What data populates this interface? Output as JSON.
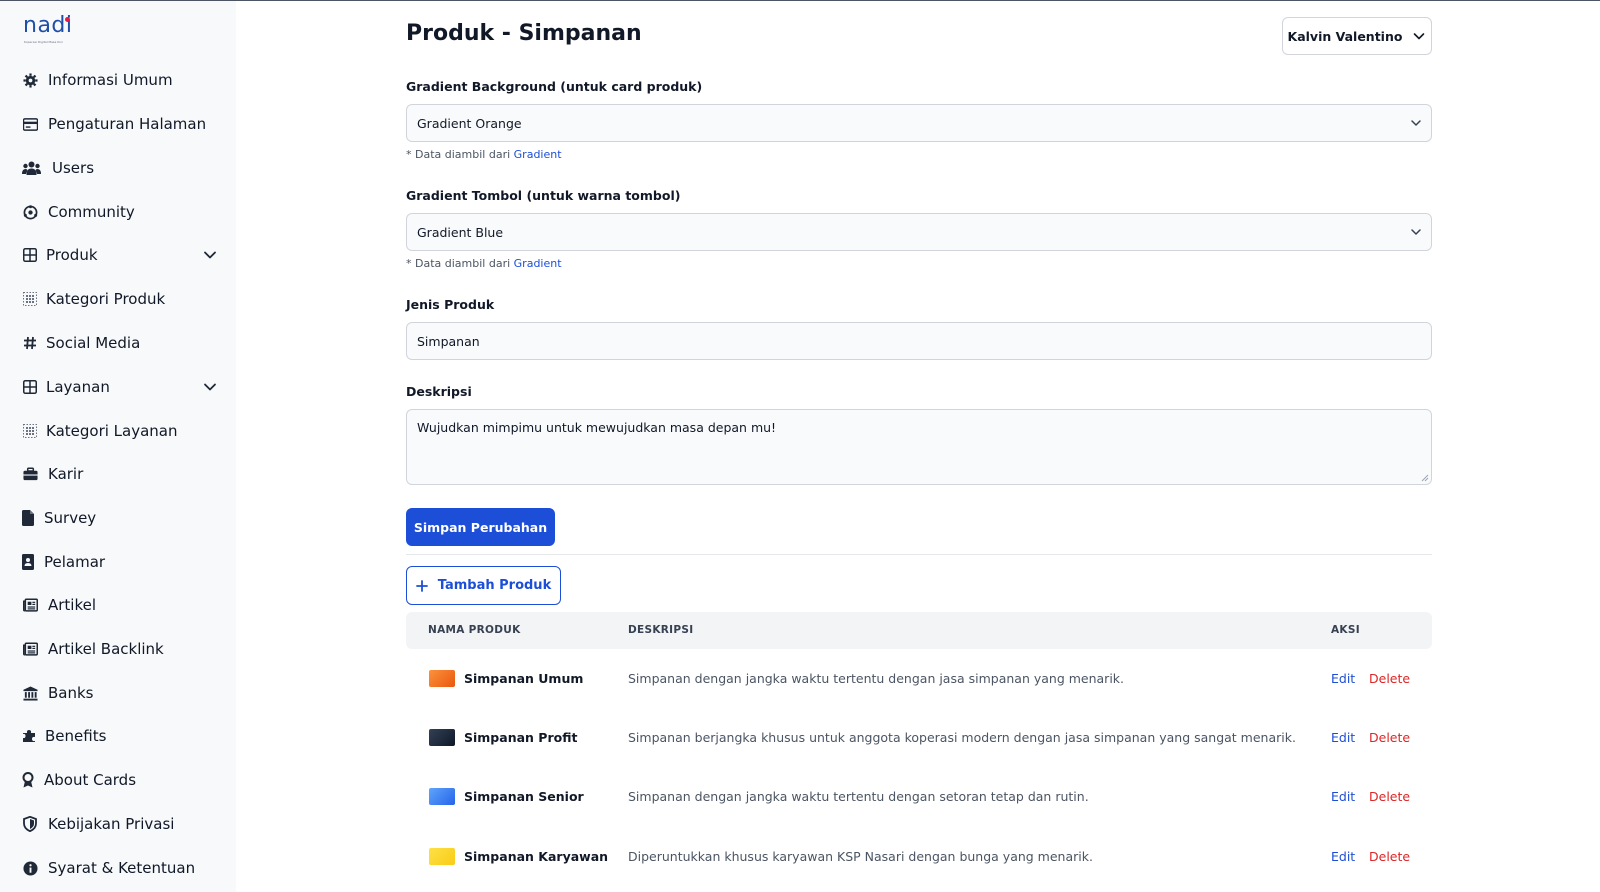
{
  "logo": {
    "text": "nadi",
    "subtitle": "Koperasi Digital Masa Kini"
  },
  "sidebar": {
    "items": [
      {
        "label": "Informasi Umum",
        "icon": "gear-icon"
      },
      {
        "label": "Pengaturan Halaman",
        "icon": "card-icon"
      },
      {
        "label": "Users",
        "icon": "users-icon"
      },
      {
        "label": "Community",
        "icon": "community-icon"
      },
      {
        "label": "Produk",
        "icon": "grid-icon",
        "expandable": true
      },
      {
        "label": "Kategori Produk",
        "icon": "dots-grid-icon"
      },
      {
        "label": "Social Media",
        "icon": "hash-icon"
      },
      {
        "label": "Layanan",
        "icon": "grid-icon",
        "expandable": true
      },
      {
        "label": "Kategori Layanan",
        "icon": "dots-grid-icon"
      },
      {
        "label": "Karir",
        "icon": "briefcase-icon"
      },
      {
        "label": "Survey",
        "icon": "document-icon"
      },
      {
        "label": "Pelamar",
        "icon": "id-card-icon"
      },
      {
        "label": "Artikel",
        "icon": "newspaper-icon"
      },
      {
        "label": "Artikel Backlink",
        "icon": "newspaper-icon"
      },
      {
        "label": "Banks",
        "icon": "bank-icon"
      },
      {
        "label": "Benefits",
        "icon": "puzzle-icon"
      },
      {
        "label": "About Cards",
        "icon": "award-icon"
      },
      {
        "label": "Kebijakan Privasi",
        "icon": "shield-icon"
      },
      {
        "label": "Syarat & Ketentuan",
        "icon": "info-icon"
      }
    ]
  },
  "header": {
    "title": "Produk - Simpanan",
    "user": "Kalvin Valentino"
  },
  "form": {
    "gradient_bg": {
      "label": "Gradient Background (untuk card produk)",
      "value": "Gradient Orange",
      "hint_prefix": "* Data diambil dari",
      "hint_link": "Gradient"
    },
    "gradient_btn": {
      "label": "Gradient Tombol (untuk warna tombol)",
      "value": "Gradient Blue",
      "hint_prefix": "* Data diambil dari",
      "hint_link": "Gradient"
    },
    "jenis": {
      "label": "Jenis Produk",
      "value": "Simpanan"
    },
    "deskripsi": {
      "label": "Deskripsi",
      "value": "Wujudkan mimpimu untuk mewujudkan masa depan mu!"
    },
    "save_label": "Simpan Perubahan",
    "add_label": "Tambah Produk"
  },
  "table": {
    "columns": [
      "NAMA PRODUK",
      "DESKRIPSI",
      "AKSI"
    ],
    "edit_label": "Edit",
    "delete_label": "Delete",
    "rows": [
      {
        "name": "Simpanan Umum",
        "desc": "Simpanan dengan jangka waktu tertentu dengan jasa simpanan yang menarik.",
        "thumb_color": "#f97316"
      },
      {
        "name": "Simpanan Profit",
        "desc": "Simpanan berjangka khusus untuk anggota koperasi modern dengan jasa simpanan yang sangat menarik.",
        "thumb_color": "#1e293b"
      },
      {
        "name": "Simpanan Senior",
        "desc": "Simpanan dengan jangka waktu tertentu dengan setoran tetap dan rutin.",
        "thumb_color": "#3b82f6"
      },
      {
        "name": "Simpanan Karyawan",
        "desc": "Diperuntukkan khusus karyawan KSP Nasari dengan bunga yang menarik.",
        "thumb_color": "#facc15"
      }
    ]
  }
}
